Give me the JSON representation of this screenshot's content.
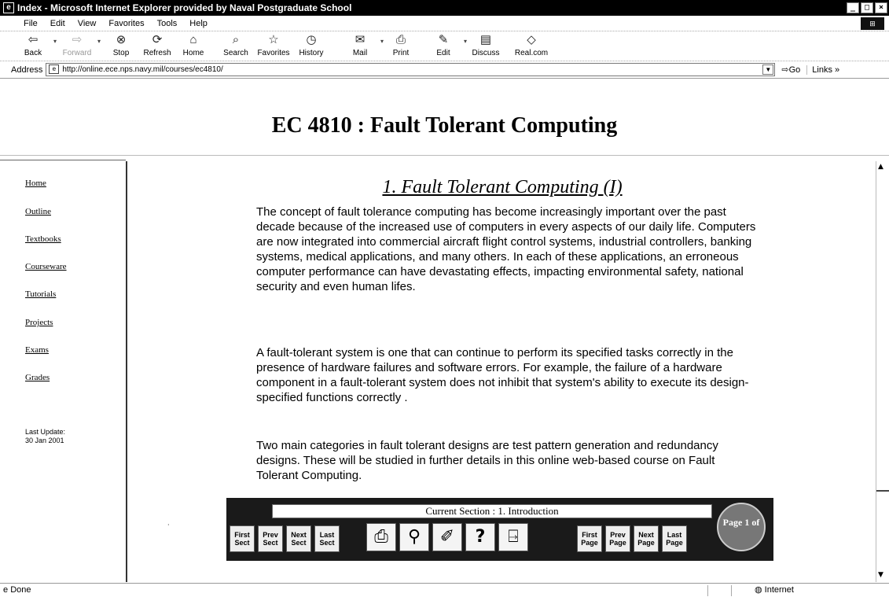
{
  "window": {
    "title": "Index - Microsoft Internet Explorer provided by Naval Postgraduate School",
    "controls": [
      "_",
      "□",
      "×"
    ]
  },
  "menu": [
    "File",
    "Edit",
    "View",
    "Favorites",
    "Tools",
    "Help"
  ],
  "toolbar": {
    "back": "Back",
    "forward": "Forward",
    "stop": "Stop",
    "refresh": "Refresh",
    "home": "Home",
    "search": "Search",
    "favorites": "Favorites",
    "history": "History",
    "mail": "Mail",
    "print": "Print",
    "edit": "Edit",
    "discuss": "Discuss",
    "realcom": "Real.com"
  },
  "address": {
    "label": "Address",
    "url": "http://online.ece.nps.navy.mil/courses/ec4810/",
    "go": "Go",
    "links": "Links »"
  },
  "page": {
    "title": "EC 4810 : Fault Tolerant Computing"
  },
  "sidebar": {
    "items": [
      "Home",
      "Outline",
      "Textbooks",
      "Courseware",
      "Tutorials",
      "Projects",
      "Exams",
      "Grades"
    ],
    "last_update_label": "Last Update:",
    "last_update_date": "30 Jan 2001"
  },
  "content": {
    "section_title": "1.  Fault Tolerant Computing (I)",
    "paragraphs": [
      "The concept of fault tolerance computing has become increasingly important over the past decade because of the increased use of computers in every aspects of our daily life. Computers are now integrated into commercial aircraft flight control systems, industrial controllers, banking systems, medical applications, and many others. In each of these applications, an erroneous computer performance can have devastating effects, impacting environmental safety, national security and even human lifes.",
      "A fault-tolerant system is one that can continue to perform its specified tasks correctly in the presence of hardware failures and software errors. For example, the failure of a hardware component in a fault-tolerant system does not inhibit that system's ability to execute its design-specified functions correctly .",
      "Two main categories in fault tolerant designs are test pattern generation and redundancy designs.  These will be studied in further details in this online web-based course on Fault Tolerant Computing."
    ]
  },
  "navbar": {
    "current_section": "Current Section : 1.   Introduction",
    "first_sect": "First Sect",
    "prev_sect": "Prev Sect",
    "next_sect": "Next Sect",
    "last_sect": "Last Sect",
    "first_page": "First Page",
    "prev_page": "Prev Page",
    "next_page": "Next Page",
    "last_page": "Last Page",
    "page_of": "Page 1 of"
  },
  "status": {
    "text": "Done",
    "zone": "Internet"
  }
}
